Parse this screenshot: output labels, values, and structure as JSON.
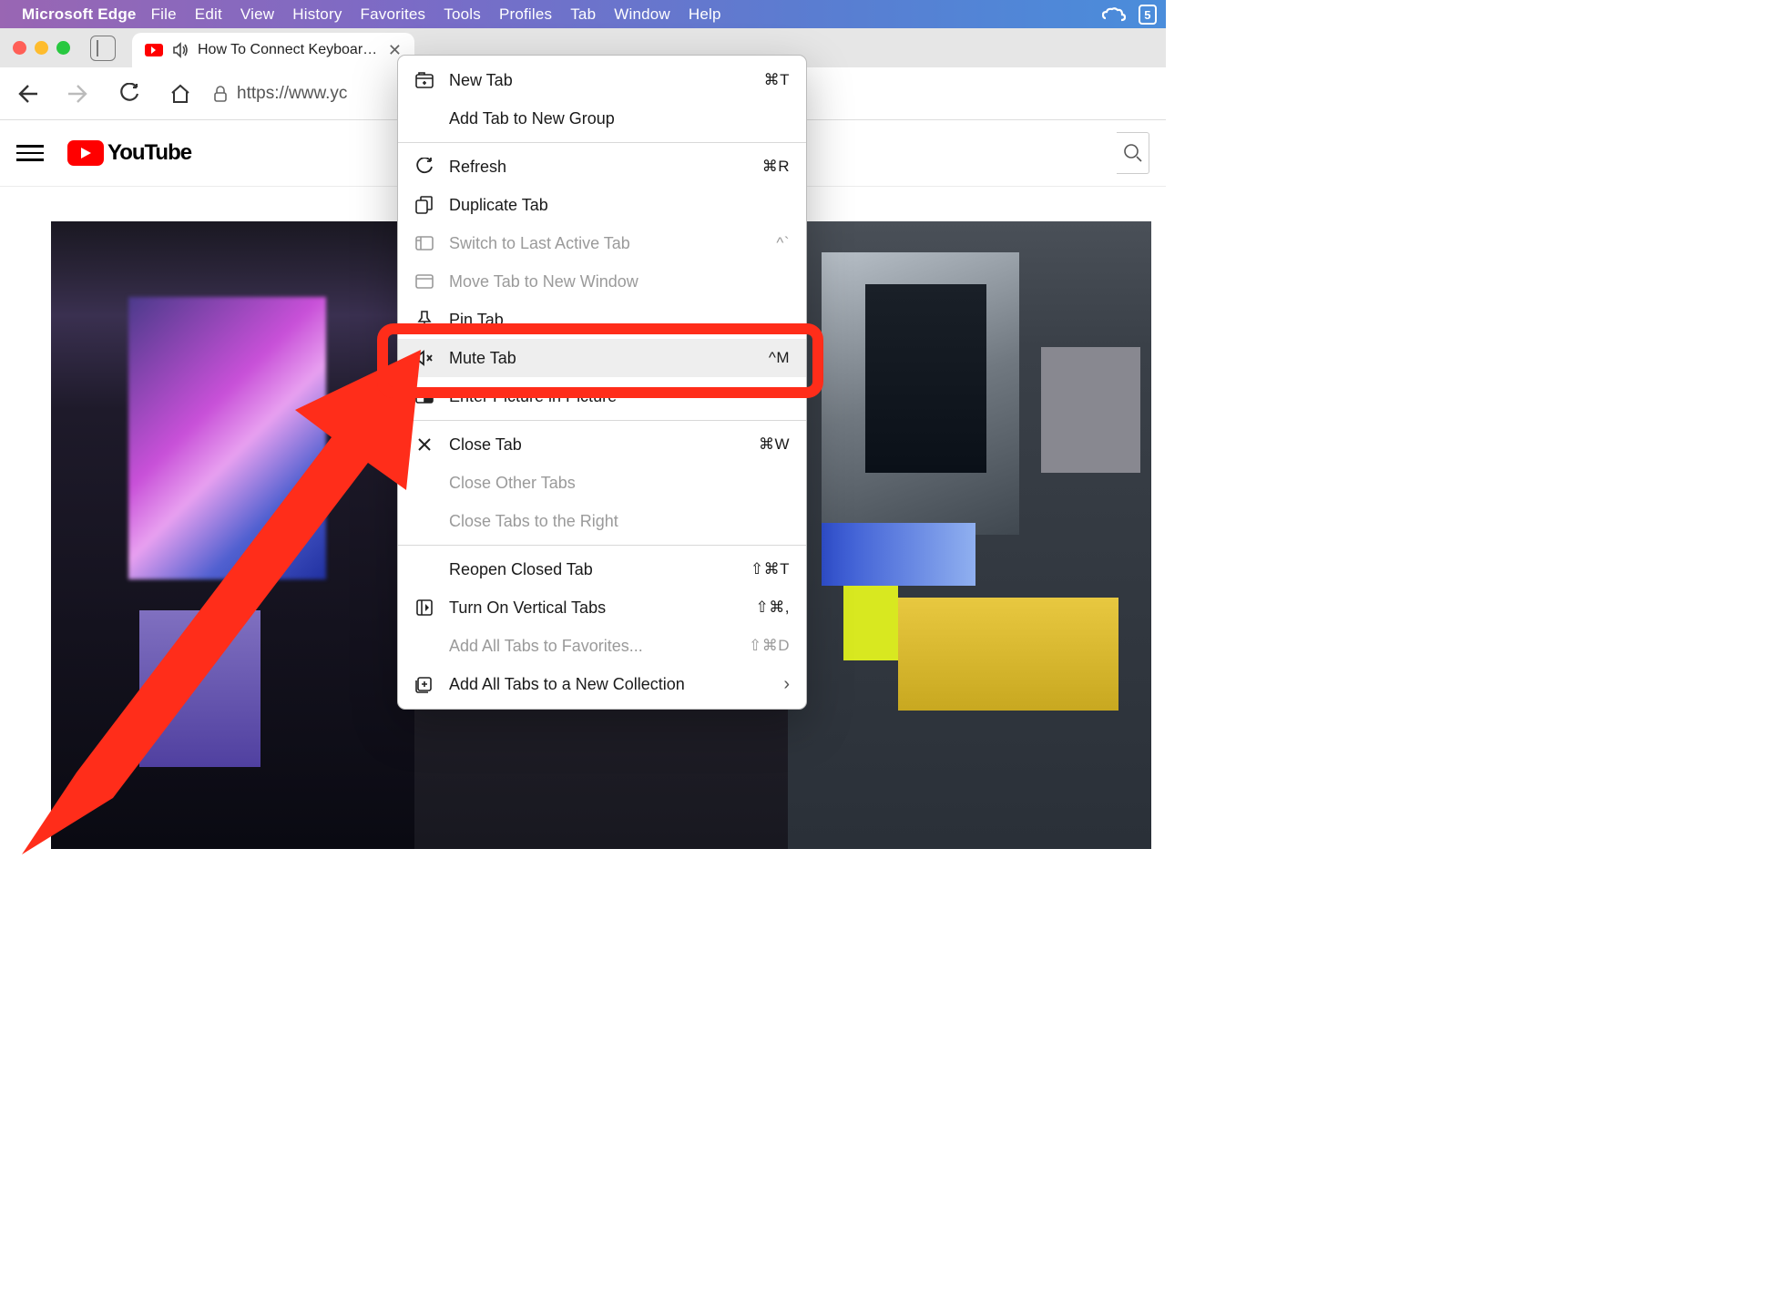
{
  "menubar": {
    "app": "Microsoft Edge",
    "items": [
      "File",
      "Edit",
      "View",
      "History",
      "Favorites",
      "Tools",
      "Profiles",
      "Tab",
      "Window",
      "Help"
    ]
  },
  "tab": {
    "title": "How To Connect Keyboar…"
  },
  "address": {
    "url": "https://www.yc"
  },
  "youtube": {
    "brand": "YouTube"
  },
  "context_menu": {
    "items": [
      {
        "key": "new-tab",
        "label": "New Tab",
        "shortcut": "⌘T",
        "icon": "plus-tab",
        "enabled": true
      },
      {
        "key": "add-group",
        "label": "Add Tab to New Group",
        "shortcut": "",
        "icon": "",
        "enabled": true
      },
      {
        "sep": true
      },
      {
        "key": "refresh",
        "label": "Refresh",
        "shortcut": "⌘R",
        "icon": "refresh",
        "enabled": true
      },
      {
        "key": "duplicate",
        "label": "Duplicate Tab",
        "shortcut": "",
        "icon": "duplicate",
        "enabled": true
      },
      {
        "key": "switch-last",
        "label": "Switch to Last Active Tab",
        "shortcut": "^`",
        "icon": "switch",
        "enabled": false
      },
      {
        "key": "move-window",
        "label": "Move Tab to New Window",
        "shortcut": "",
        "icon": "window",
        "enabled": false
      },
      {
        "key": "pin",
        "label": "Pin Tab",
        "shortcut": "",
        "icon": "pin",
        "enabled": true
      },
      {
        "key": "mute",
        "label": "Mute Tab",
        "shortcut": "^M",
        "icon": "mute",
        "enabled": true,
        "hover": true
      },
      {
        "key": "pip",
        "label": "Enter Picture in Picture",
        "shortcut": "",
        "icon": "pip",
        "enabled": true
      },
      {
        "sep": true
      },
      {
        "key": "close",
        "label": "Close Tab",
        "shortcut": "⌘W",
        "icon": "close",
        "enabled": true
      },
      {
        "key": "close-other",
        "label": "Close Other Tabs",
        "shortcut": "",
        "icon": "",
        "enabled": false
      },
      {
        "key": "close-right",
        "label": "Close Tabs to the Right",
        "shortcut": "",
        "icon": "",
        "enabled": false
      },
      {
        "sep": true
      },
      {
        "key": "reopen",
        "label": "Reopen Closed Tab",
        "shortcut": "⇧⌘T",
        "icon": "",
        "enabled": true
      },
      {
        "key": "vertical",
        "label": "Turn On Vertical Tabs",
        "shortcut": "⇧⌘,",
        "icon": "vertical",
        "enabled": true
      },
      {
        "key": "add-fav",
        "label": "Add All Tabs to Favorites...",
        "shortcut": "⇧⌘D",
        "icon": "",
        "enabled": false
      },
      {
        "key": "add-collection",
        "label": "Add All Tabs to a New Collection",
        "shortcut": "",
        "icon": "collection",
        "enabled": true,
        "chevron": true
      }
    ]
  }
}
